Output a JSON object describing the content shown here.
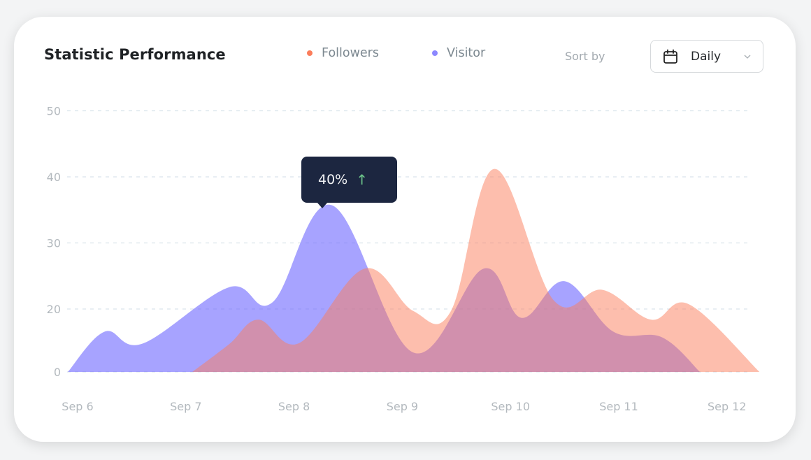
{
  "header": {
    "title": "Statistic Performance",
    "sort_label": "Sort by",
    "sort_value": "Daily",
    "calendar_icon": "calendar-icon",
    "chevron_icon": "chevron-down-icon"
  },
  "legend": [
    {
      "name": "Followers",
      "color": "#fb7d5b"
    },
    {
      "name": "Visitor",
      "color": "#8c88ff"
    }
  ],
  "tooltip": {
    "value": "40%",
    "arrow": "↑",
    "arrow_icon": "arrow-up-icon",
    "arrow_color": "#6cc48a"
  },
  "chart_data": {
    "type": "area",
    "title": "Statistic Performance",
    "xlabel": "",
    "ylabel": "",
    "x_tick_labels": [
      "Sep 6",
      "Sep 7",
      "Sep 8",
      "Sep 9",
      "Sep 10",
      "Sep 11",
      "Sep 12"
    ],
    "y_tick_labels": [
      "50",
      "40",
      "30",
      "20",
      "0"
    ],
    "y_tick_values": [
      50,
      40,
      30,
      20,
      10
    ],
    "ylim": [
      10,
      50
    ],
    "grid": true,
    "legend_position": "top-center",
    "series": [
      {
        "name": "Visitor",
        "color": "#8c88ff",
        "points": [
          [
            -0.09,
            10
          ],
          [
            0.25,
            16.4
          ],
          [
            0.6,
            14.5
          ],
          [
            1.4,
            23.3
          ],
          [
            1.8,
            21
          ],
          [
            2.35,
            35.7
          ],
          [
            3.1,
            13.1
          ],
          [
            3.75,
            26.1
          ],
          [
            4.1,
            18.6
          ],
          [
            4.5,
            24.2
          ],
          [
            4.95,
            16.4
          ],
          [
            5.4,
            15.5
          ],
          [
            5.75,
            10
          ]
        ]
      },
      {
        "name": "Followers",
        "color": "#fb7d5b",
        "points": [
          [
            1.06,
            10
          ],
          [
            1.4,
            14.4
          ],
          [
            1.67,
            18.3
          ],
          [
            2.05,
            14.6
          ],
          [
            2.65,
            26.1
          ],
          [
            3.1,
            19.7
          ],
          [
            3.45,
            19.7
          ],
          [
            3.85,
            41.2
          ],
          [
            4.4,
            21.3
          ],
          [
            4.85,
            22.9
          ],
          [
            5.3,
            18.3
          ],
          [
            5.65,
            20.7
          ],
          [
            6.3,
            10
          ]
        ]
      }
    ],
    "annotation": {
      "text": "40%",
      "series": "Visitor",
      "x": 2.35
    }
  }
}
